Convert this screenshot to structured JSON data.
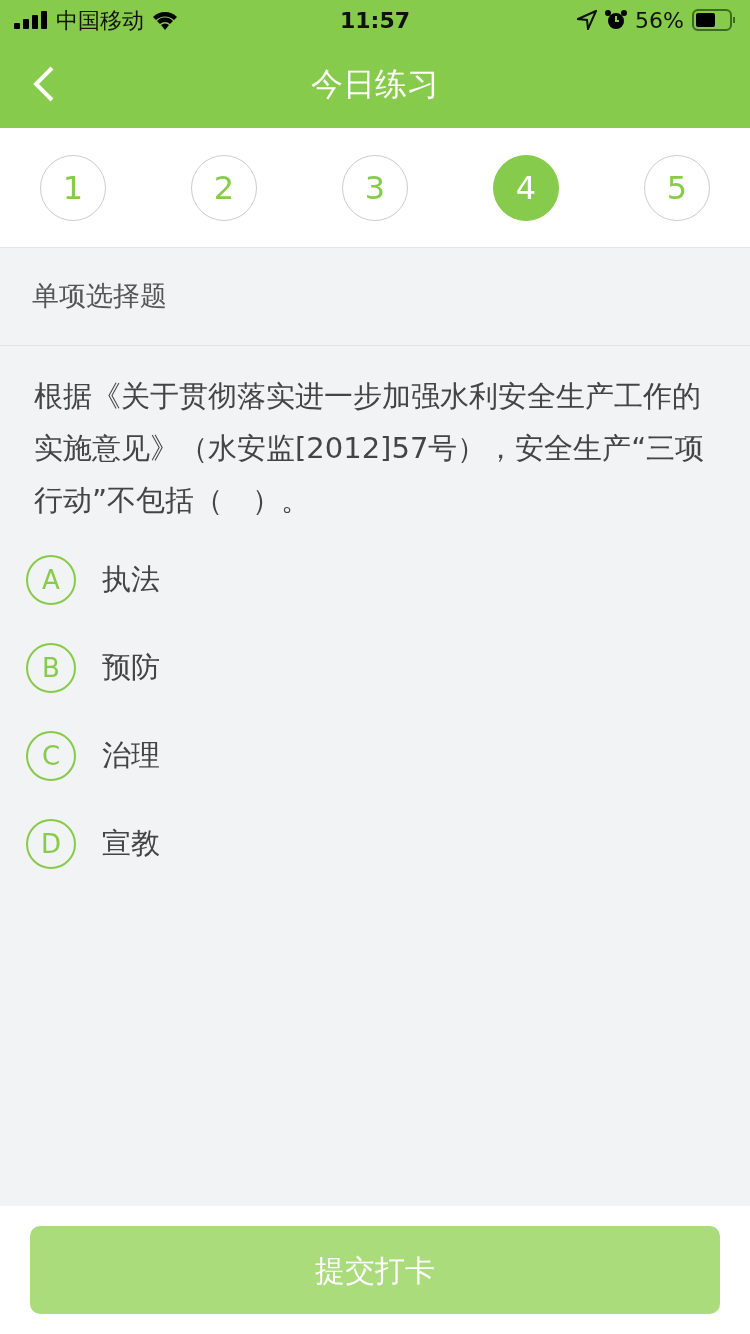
{
  "status_bar": {
    "carrier": "中国移动",
    "time": "11:57",
    "battery": "56%"
  },
  "header": {
    "title": "今日练习"
  },
  "questions": [
    {
      "label": "1",
      "selected": false
    },
    {
      "label": "2",
      "selected": false
    },
    {
      "label": "3",
      "selected": false
    },
    {
      "label": "4",
      "selected": true
    },
    {
      "label": "5",
      "selected": false
    }
  ],
  "section": {
    "title": "单项选择题"
  },
  "question": {
    "text": "根据《关于贯彻落实进一步加强水利安全生产工作的实施意见》（水安监[2012]57号），安全生产“三项行动”不包括（　）。"
  },
  "options": [
    {
      "letter": "A",
      "text": "执法",
      "selected": false
    },
    {
      "letter": "B",
      "text": "预防",
      "selected": false
    },
    {
      "letter": "C",
      "text": "治理",
      "selected": false
    },
    {
      "letter": "D",
      "text": "宣教",
      "selected": false
    }
  ],
  "submit": {
    "label": "提交打卡",
    "disabled": true
  }
}
